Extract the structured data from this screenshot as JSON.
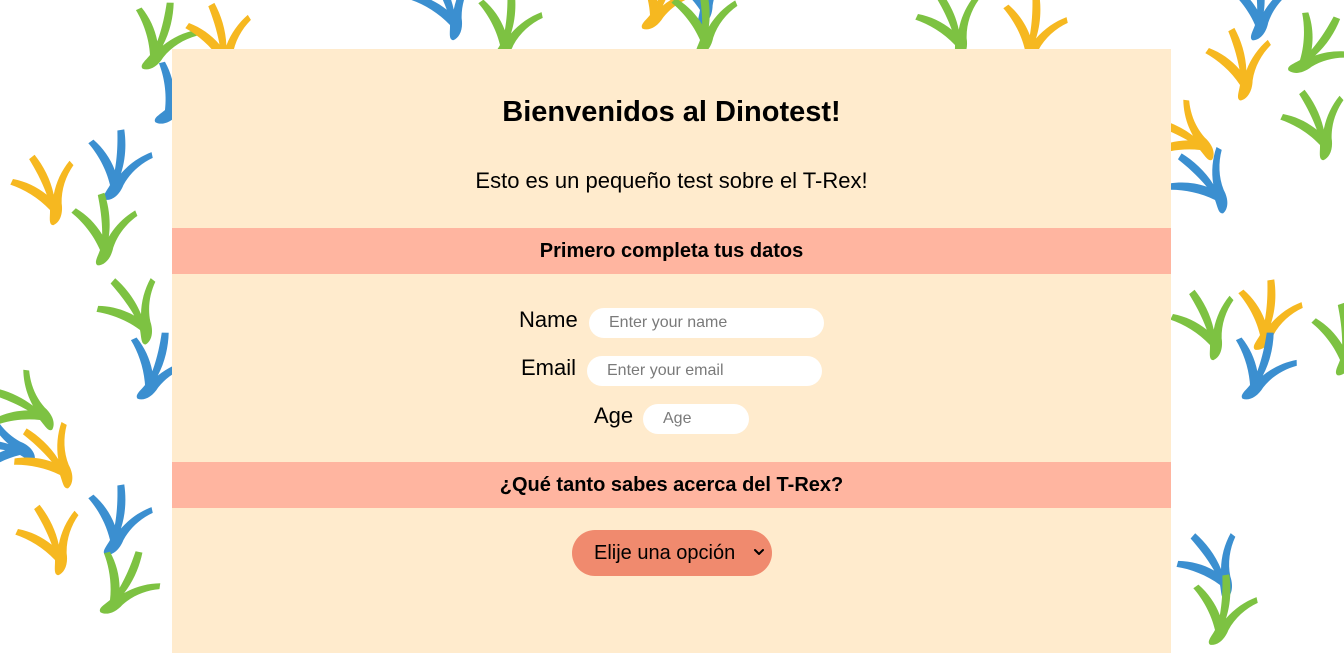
{
  "header": {
    "title": "Bienvenidos al Dinotest!",
    "subtitle": "Esto es un pequeño test sobre el T-Rex!"
  },
  "sections": {
    "personal": {
      "heading": "Primero completa tus datos",
      "fields": {
        "name": {
          "label": "Name",
          "placeholder": "Enter your name",
          "value": ""
        },
        "email": {
          "label": "Email",
          "placeholder": "Enter your email",
          "value": ""
        },
        "age": {
          "label": "Age",
          "placeholder": "Age",
          "value": ""
        }
      }
    },
    "quiz": {
      "heading": "¿Qué tanto sabes acerca del T-Rex?",
      "select": {
        "selected": "Elije una opción",
        "icon": "chevron-down-icon"
      }
    }
  },
  "colors": {
    "panel_bg": "#ffebcd",
    "band_bg": "#ffb5a0",
    "select_bg": "#f08a6e",
    "footprint_green": "#7dc242",
    "footprint_blue": "#3b8fd0",
    "footprint_yellow": "#f6b820"
  },
  "background": {
    "icon": "dino-footprint-icon"
  }
}
